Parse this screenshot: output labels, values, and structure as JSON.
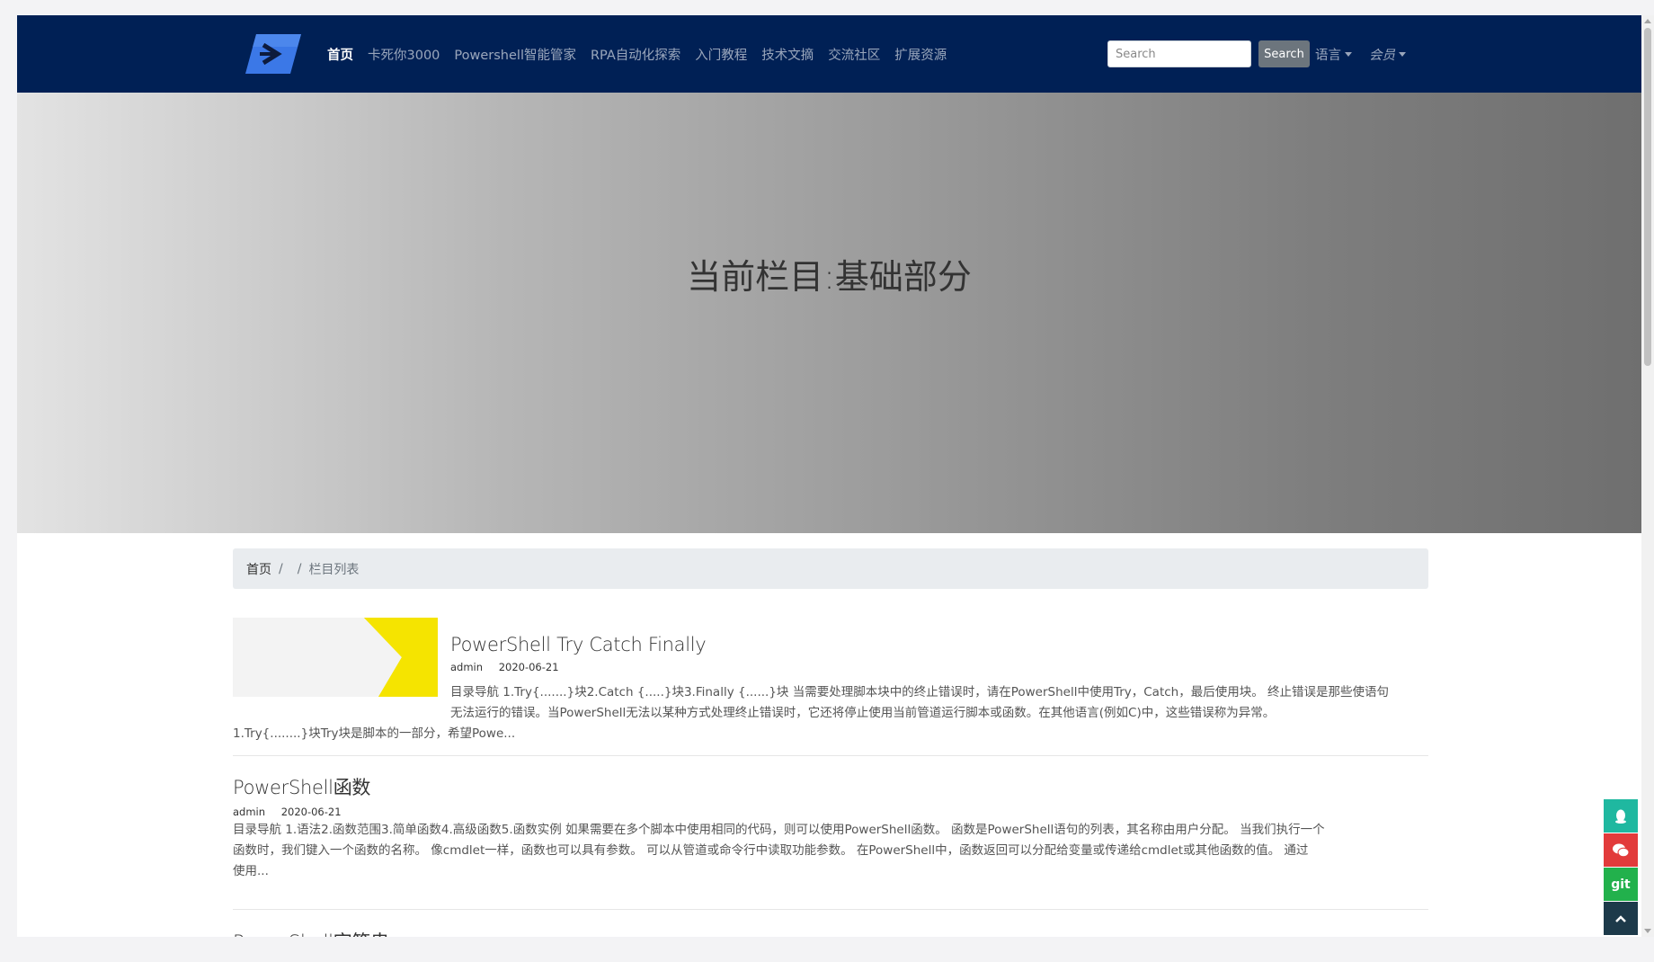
{
  "navbar": {
    "items": [
      {
        "label": "首页",
        "active": true
      },
      {
        "label": "卡死你3000"
      },
      {
        "label": "Powershell智能管家"
      },
      {
        "label": "RPA自动化探索"
      },
      {
        "label": "入门教程"
      },
      {
        "label": "技术文摘"
      },
      {
        "label": "交流社区"
      },
      {
        "label": "扩展资源"
      }
    ],
    "search_placeholder": "Search",
    "search_button": "Search",
    "language_label": "语言",
    "member_label": "会员"
  },
  "hero": {
    "title": "当前栏目:基础部分"
  },
  "breadcrumb": {
    "home": "首页",
    "sep1": "/",
    "sep2": "/",
    "current": "栏目列表"
  },
  "articles": [
    {
      "title": "PowerShell Try Catch Finally",
      "author": "admin",
      "date": "2020-06-21",
      "excerpt_line1": "目录导航 1.Try{.......}块2.Catch {.....}块3.Finally {......}块 当需要处理脚本块中的终止错误时，请在PowerShell中使用Try，Catch，最后使用块。 终止错误是那些使语句",
      "excerpt_line2": "无法运行的错误。当PowerShell无法以某种方式处理终止错误时，它还将停止使用当前管道运行脚本或函数。在其他语言(例如C)中，这些错误称为异常。",
      "excerpt_line3": "1.Try{........}块Try块是脚本的一部分，希望Powe..."
    },
    {
      "title": "PowerShell函数",
      "author": "admin",
      "date": "2020-06-21",
      "excerpt_line1": "目录导航 1.语法2.函数范围3.简单函数4.高级函数5.函数实例 如果需要在多个脚本中使用相同的代码，则可以使用PowerShell函数。 函数是PowerShell语句的列表，其名称由用户分配。 当我们执行一个",
      "excerpt_line2": "函数时，我们键入一个函数的名称。 像cmdlet一样，函数也可以具有参数。 可以从管道或命令行中读取功能参数。 在PowerShell中，函数返回可以分配给变量或传递给cmdlet或其他函数的值。 通过",
      "excerpt_line3": "使用..."
    },
    {
      "title": "PowerShell字符串"
    }
  ],
  "side_buttons": {
    "git_label": "git"
  },
  "colors": {
    "navbar_bg": "#002055",
    "thumb_accent": "#f5e400",
    "qq": "#1fb8a0",
    "wechat": "#e23b3b",
    "git": "#22b14c",
    "top": "#1d3a4a"
  }
}
